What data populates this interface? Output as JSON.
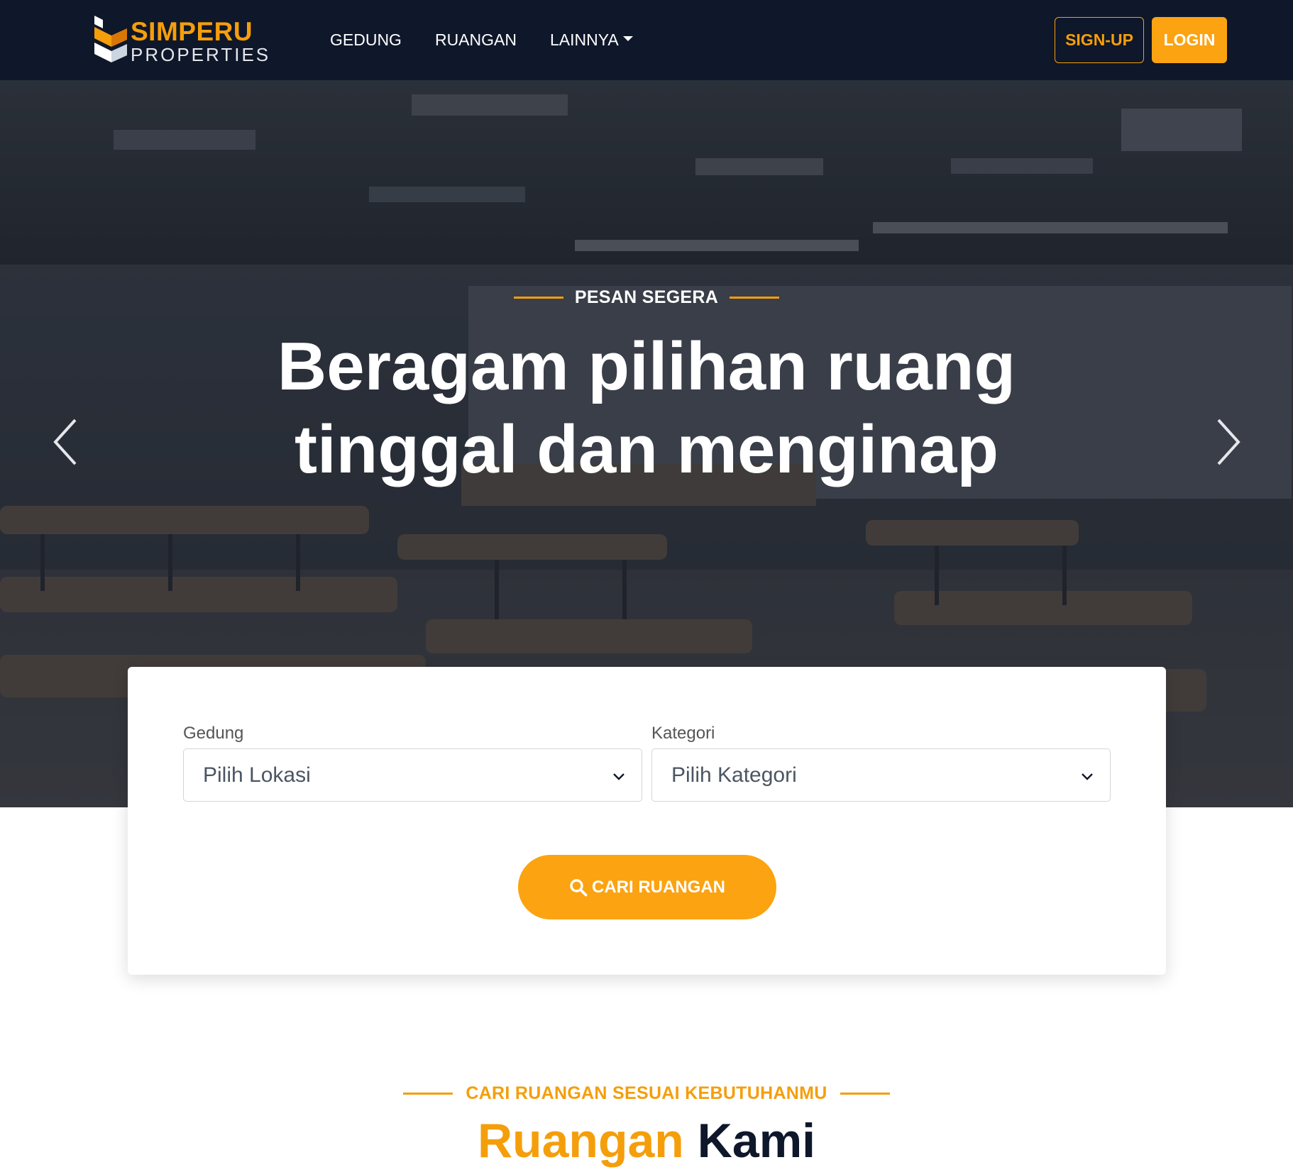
{
  "brand": {
    "name_top": "SIMPERU",
    "name_bottom": "PROPERTIES"
  },
  "nav": {
    "items": [
      {
        "label": "GEDUNG"
      },
      {
        "label": "RUANGAN"
      },
      {
        "label": "LAINNYA"
      }
    ],
    "signup_label": "SIGN-UP",
    "login_label": "LOGIN"
  },
  "hero": {
    "eyebrow": "PESAN SEGERA",
    "title": "Beragam pilihan ruang tinggal dan menginap"
  },
  "search": {
    "gedung_label": "Gedung",
    "gedung_value": "Pilih Lokasi",
    "kategori_label": "Kategori",
    "kategori_value": "Pilih Kategori",
    "button_label": "CARI RUANGAN"
  },
  "section": {
    "eyebrow": "CARI RUANGAN SESUAI KEBUTUHANMU",
    "title_accent": "Ruangan",
    "title_rest": "Kami"
  },
  "colors": {
    "navbar_bg": "#0f172a",
    "accent": "#f59e0b",
    "button_orange": "#fca311"
  },
  "icons": {
    "logo": "simperu-logo-icon",
    "dropdown_caret": "caret-down-icon",
    "prev": "chevron-left-icon",
    "next": "chevron-right-icon",
    "select_chevron": "chevron-down-icon",
    "search": "search-icon"
  }
}
